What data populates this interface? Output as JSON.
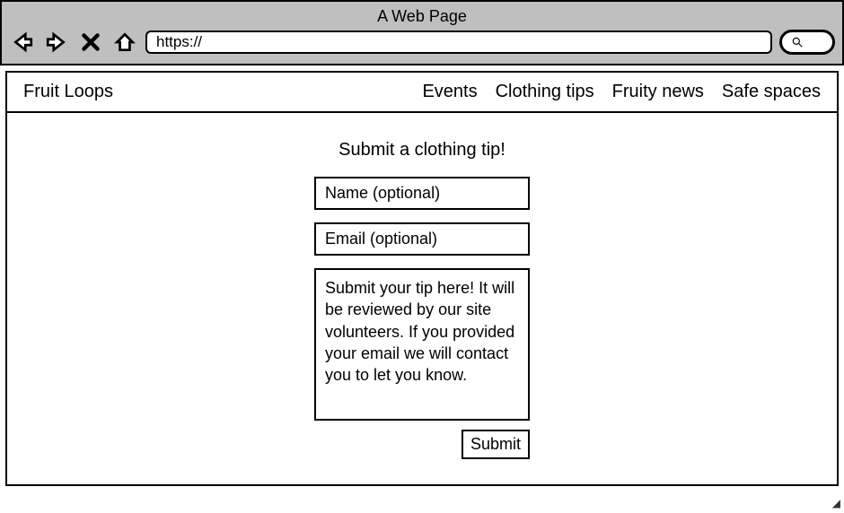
{
  "browser": {
    "title": "A Web Page",
    "url": "https://"
  },
  "navbar": {
    "brand": "Fruit Loops",
    "links": [
      "Events",
      "Clothing tips",
      "Fruity news",
      "Safe spaces"
    ]
  },
  "form": {
    "heading": "Submit a clothing tip!",
    "name_placeholder": "Name (optional)",
    "email_placeholder": "Email (optional)",
    "tip_placeholder": "Submit your tip here! It will be reviewed by our site volunteers. If you provided your email we will contact you to let you know.",
    "submit_label": "Submit"
  }
}
